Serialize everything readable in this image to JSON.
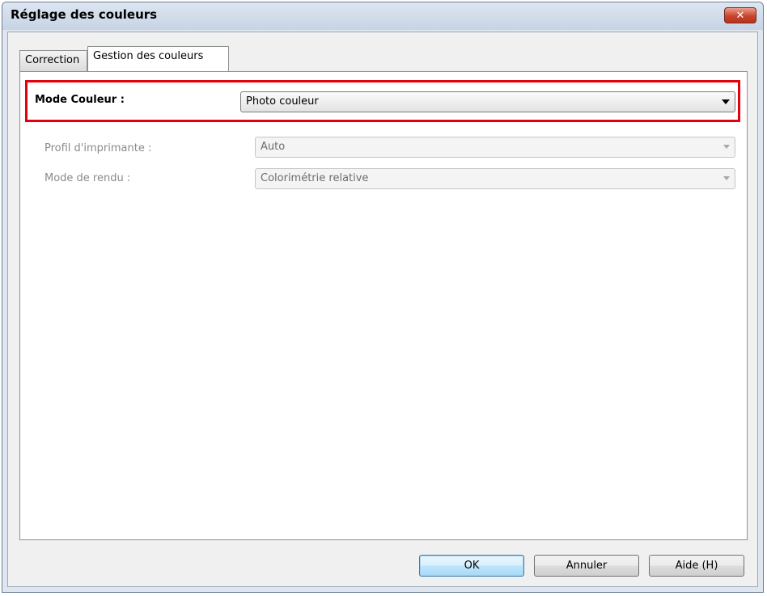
{
  "window": {
    "title": "Réglage des couleurs",
    "close_glyph": "✕"
  },
  "tabs": [
    {
      "label": "Correction",
      "active": false
    },
    {
      "label": "Gestion des couleurs",
      "active": true
    }
  ],
  "panel": {
    "highlight_color": "#e6000e",
    "color_mode": {
      "label": "Mode Couleur :",
      "value": "Photo couleur",
      "enabled": true
    },
    "printer_profile": {
      "label": "Profil d'imprimante :",
      "value": "Auto",
      "enabled": false
    },
    "rendering_intent": {
      "label": "Mode de rendu :",
      "value": "Colorimétrie relative",
      "enabled": false
    }
  },
  "buttons": {
    "ok": "OK",
    "cancel": "Annuler",
    "help": "Aide (H)"
  }
}
